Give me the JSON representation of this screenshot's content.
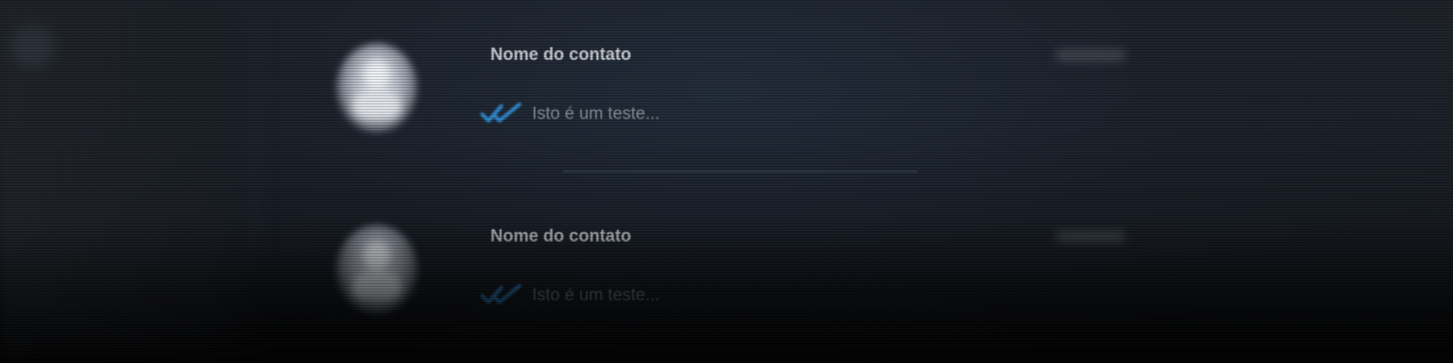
{
  "colors": {
    "background": "#1a1f27",
    "name_text": "#c9ccd2",
    "message_text": "#8a8f98",
    "read_ticks": "#2f8fd8"
  },
  "chat_list": {
    "items": [
      {
        "contact_name": "Nome do contato",
        "message_preview": "Isto é um teste...",
        "status_icon": "double-check-icon"
      },
      {
        "contact_name": "Nome do contato",
        "message_preview": "Isto é um teste...",
        "status_icon": "double-check-icon"
      }
    ]
  }
}
